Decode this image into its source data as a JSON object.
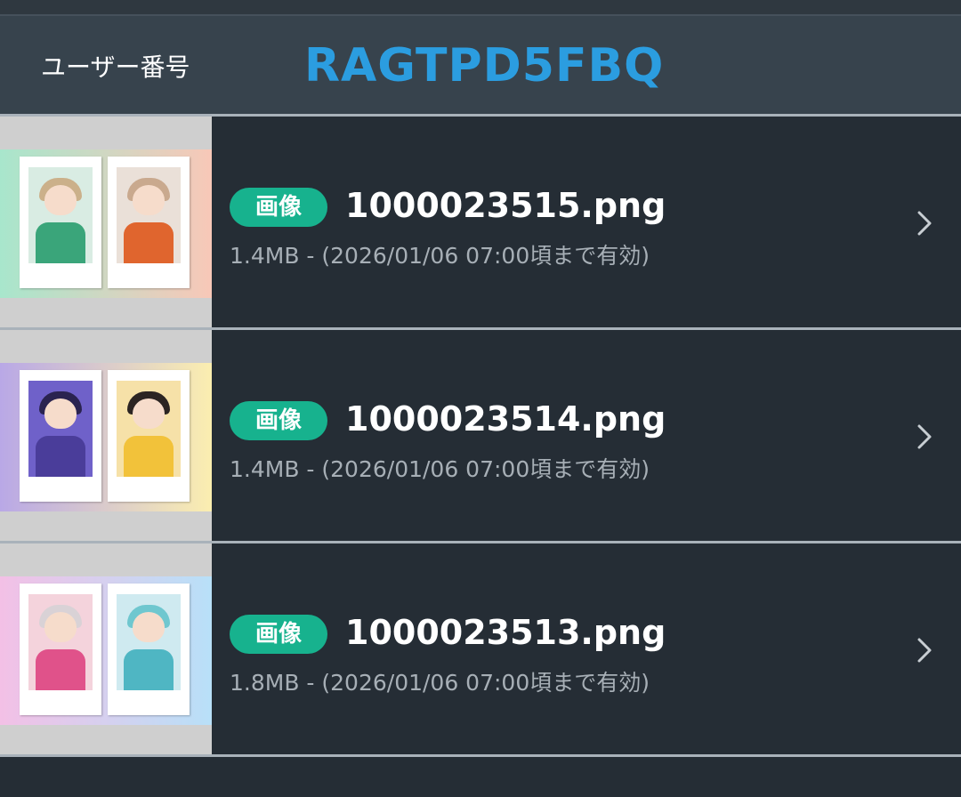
{
  "header": {
    "user_label": "ユーザー番号",
    "user_id": "RAGTPD5FBQ"
  },
  "files": [
    {
      "badge": "画像",
      "name": "1000023515.png",
      "meta": "1.4MB - (2026/01/06 07:00頃まで有効)",
      "thumb_colors": {
        "band_left": "#a8e6cc",
        "band_right": "#f8c8b8",
        "hair_a": "#cbb08a",
        "body_a": "#3aa57a",
        "hair_b": "#c9a98e",
        "body_b": "#e0652e",
        "bg_a": "#d9ece3",
        "bg_b": "#eae0d8"
      }
    },
    {
      "badge": "画像",
      "name": "1000023514.png",
      "meta": "1.4MB - (2026/01/06 07:00頃まで有効)",
      "thumb_colors": {
        "band_left": "#b9a8e6",
        "band_right": "#fbeeb0",
        "hair_a": "#2a2350",
        "body_a": "#4a3d9a",
        "hair_b": "#2b2422",
        "body_b": "#f2c23a",
        "bg_a": "#6f61c9",
        "bg_b": "#f6e1a8"
      }
    },
    {
      "badge": "画像",
      "name": "1000023513.png",
      "meta": "1.8MB - (2026/01/06 07:00頃まで有効)",
      "thumb_colors": {
        "band_left": "#f3c0e6",
        "band_right": "#b8e0f8",
        "hair_a": "#d9d2d6",
        "body_a": "#e0528a",
        "hair_b": "#6fc7cf",
        "body_b": "#4fb6c3",
        "bg_a": "#f4d3dc",
        "bg_b": "#cfeaf0"
      }
    }
  ]
}
